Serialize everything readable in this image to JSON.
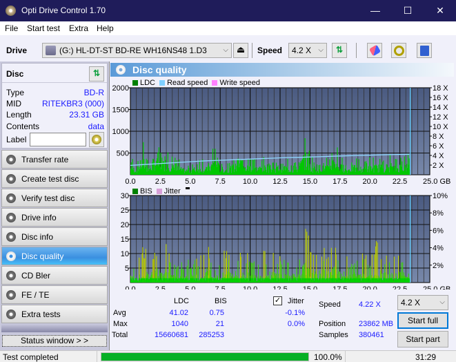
{
  "window": {
    "title": "Opti Drive Control 1.70",
    "minimize": "—",
    "maximize": "☐",
    "close": "✕"
  },
  "menu": [
    "File",
    "Start test",
    "Extra",
    "Help"
  ],
  "toolbar": {
    "drive_label": "Drive",
    "drive_value": "(G:)  HL-DT-ST BD-RE  WH16NS48 1.D3",
    "speed_label": "Speed",
    "speed_value": "4.2 X"
  },
  "disc": {
    "header": "Disc",
    "type_label": "Type",
    "type": "BD-R",
    "mid_label": "MID",
    "mid": "RITEKBR3 (000)",
    "length_label": "Length",
    "length": "23.31 GB",
    "contents_label": "Contents",
    "contents": "data",
    "label_label": "Label",
    "label_value": ""
  },
  "nav": [
    {
      "label": "Transfer rate",
      "active": false
    },
    {
      "label": "Create test disc",
      "active": false
    },
    {
      "label": "Verify test disc",
      "active": false
    },
    {
      "label": "Drive info",
      "active": false
    },
    {
      "label": "Disc info",
      "active": false
    },
    {
      "label": "Disc quality",
      "active": true
    },
    {
      "label": "CD Bler",
      "active": false
    },
    {
      "label": "FE / TE",
      "active": false
    },
    {
      "label": "Extra tests",
      "active": false
    }
  ],
  "status_window_btn": "Status window > >",
  "panel_title": "Disc quality",
  "chart_data": [
    {
      "type": "bar",
      "title": "LDC",
      "legend": [
        "LDC",
        "Read speed",
        "Write speed"
      ],
      "legend_colors": {
        "LDC": "#008000",
        "Read speed": "#80d0ff",
        "Write speed": "#ff80ff"
      },
      "xlabel": "GB",
      "xlim": [
        0,
        25
      ],
      "x_ticks": [
        "0.0",
        "2.5",
        "5.0",
        "7.5",
        "10.0",
        "12.5",
        "15.0",
        "17.5",
        "20.0",
        "22.5",
        "25.0 GB"
      ],
      "ylim": [
        0,
        2000
      ],
      "y_ticks": [
        "2000",
        "1500",
        "1000",
        "500"
      ],
      "y2lim": [
        0,
        18
      ],
      "y2_ticks": [
        "18 X",
        "16 X",
        "14 X",
        "12 X",
        "10 X",
        "8 X",
        "6 X",
        "4 X",
        "2 X"
      ],
      "data_end_gb": 23.31,
      "ldc_profile_gb": [
        0,
        0.5,
        1,
        1.5,
        2,
        2.5,
        3,
        3.5,
        4,
        4.5,
        5,
        5.5,
        6,
        6.5,
        7,
        7.5,
        8,
        8.5,
        9,
        9.5,
        10,
        10.5,
        11,
        11.5,
        12,
        12.5,
        13,
        13.5,
        14,
        14.5,
        15,
        15.5,
        16,
        16.5,
        17,
        17.5,
        18,
        18.5,
        19,
        19.5,
        20,
        20.5,
        21,
        21.5,
        22,
        22.5,
        23,
        23.3
      ],
      "ldc_peaks": [
        420,
        300,
        820,
        350,
        830,
        550,
        760,
        430,
        380,
        250,
        300,
        360,
        400,
        300,
        840,
        350,
        300,
        450,
        520,
        400,
        470,
        380,
        420,
        390,
        330,
        500,
        420,
        300,
        380,
        1040,
        480,
        330,
        560,
        380,
        900,
        480,
        280,
        430,
        380,
        350,
        420,
        460,
        430,
        500,
        380,
        500,
        480,
        550
      ],
      "read_speed_x": [
        0,
        1,
        2,
        3,
        4,
        5,
        6,
        7,
        8,
        9,
        10,
        11,
        12,
        13,
        14,
        15,
        16,
        17,
        18,
        19,
        20,
        21,
        22,
        23,
        23.3
      ],
      "read_speed_values": [
        1.95,
        2.1,
        2.25,
        2.4,
        2.55,
        2.7,
        2.85,
        2.95,
        3.05,
        3.15,
        3.25,
        3.35,
        3.45,
        3.55,
        3.6,
        3.68,
        3.75,
        3.85,
        3.92,
        4.0,
        4.05,
        4.12,
        4.18,
        4.22,
        4.22
      ]
    },
    {
      "type": "bar",
      "title": "BIS",
      "legend": [
        "BIS",
        "Jitter"
      ],
      "legend_colors": {
        "BIS": "#008000",
        "Jitter": "#d8a0d8"
      },
      "xlabel": "GB",
      "xlim": [
        0,
        25
      ],
      "x_ticks": [
        "0.0",
        "2.5",
        "5.0",
        "7.5",
        "10.0",
        "12.5",
        "15.0",
        "17.5",
        "20.0",
        "22.5",
        "25.0 GB"
      ],
      "ylim": [
        0,
        30
      ],
      "y_ticks": [
        "30",
        "25",
        "20",
        "15",
        "10",
        "5"
      ],
      "y2lim": [
        0,
        10
      ],
      "y2_ticks": [
        "10%",
        "8%",
        "6%",
        "4%",
        "2%"
      ],
      "data_end_gb": 23.31,
      "bis_profile_gb": [
        0,
        0.5,
        1,
        1.5,
        2,
        2.5,
        3,
        3.5,
        4,
        4.5,
        5,
        5.5,
        6,
        6.5,
        7,
        7.5,
        8,
        8.5,
        9,
        9.5,
        10,
        10.5,
        11,
        11.5,
        12,
        12.5,
        13,
        13.5,
        14,
        14.5,
        15,
        15.5,
        16,
        16.5,
        17,
        17.5,
        18,
        18.5,
        19,
        19.5,
        20,
        20.5,
        21,
        21.5,
        22,
        22.5,
        23,
        23.3
      ],
      "bis_peaks": [
        9,
        5,
        16,
        9,
        17,
        12,
        15,
        8,
        6,
        9,
        8,
        9,
        10,
        17,
        8,
        8,
        13,
        14,
        10,
        13,
        8,
        9,
        13,
        11,
        12,
        10,
        8,
        11,
        9,
        21,
        15,
        10,
        14,
        12,
        17,
        14,
        9,
        11,
        9,
        11,
        10,
        15,
        13,
        11,
        10,
        12,
        9,
        11
      ]
    }
  ],
  "stats": {
    "col_ldc": "LDC",
    "col_bis": "BIS",
    "avg_label": "Avg",
    "max_label": "Max",
    "total_label": "Total",
    "ldc_avg": "41.02",
    "bis_avg": "0.75",
    "ldc_max": "1040",
    "bis_max": "21",
    "ldc_total": "15660681",
    "bis_total": "285253",
    "jitter_label": "Jitter",
    "jitter_checked": true,
    "jitter_avg": "-0.1%",
    "jitter_max": "0.0%",
    "speed_label": "Speed",
    "speed_value": "4.22 X",
    "position_label": "Position",
    "position_value": "23862 MB",
    "samples_label": "Samples",
    "samples_value": "380461",
    "speed_select": "4.2 X",
    "start_full": "Start full",
    "start_part": "Start part"
  },
  "statusbar": {
    "text": "Test completed",
    "progress": 100.0,
    "progress_text": "100.0%",
    "time": "31:29"
  }
}
